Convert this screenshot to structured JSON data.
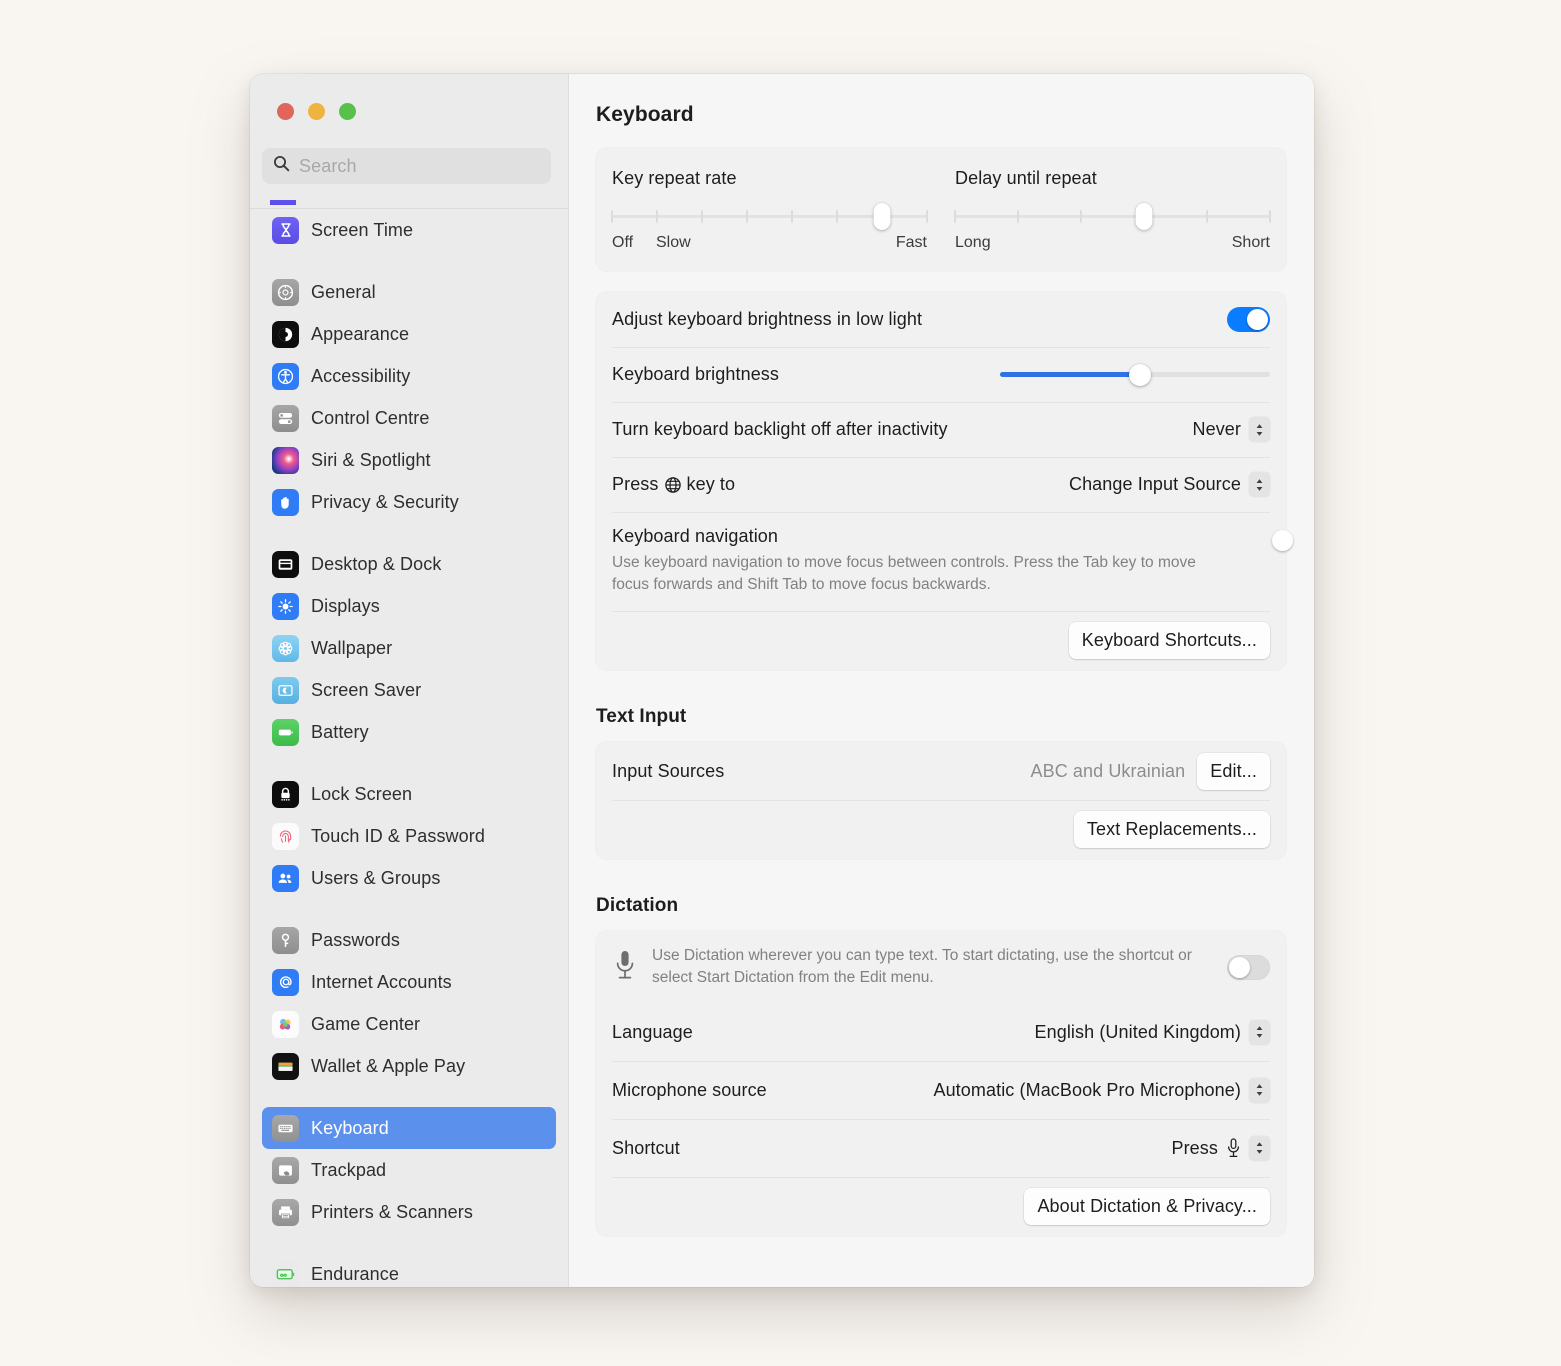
{
  "window": {
    "traffic_lights": [
      "close",
      "minimise",
      "zoom"
    ],
    "search": {
      "placeholder": "Search"
    }
  },
  "sidebar": {
    "groups": [
      {
        "items": [
          {
            "label": "Screen Time",
            "icon": "hourglass-icon"
          }
        ]
      },
      {
        "items": [
          {
            "label": "General",
            "icon": "gear-icon"
          },
          {
            "label": "Appearance",
            "icon": "appearance-icon"
          },
          {
            "label": "Accessibility",
            "icon": "accessibility-icon"
          },
          {
            "label": "Control Centre",
            "icon": "control-centre-icon"
          },
          {
            "label": "Siri & Spotlight",
            "icon": "siri-icon"
          },
          {
            "label": "Privacy & Security",
            "icon": "hand-icon"
          }
        ]
      },
      {
        "items": [
          {
            "label": "Desktop & Dock",
            "icon": "desktop-dock-icon"
          },
          {
            "label": "Displays",
            "icon": "brightness-icon"
          },
          {
            "label": "Wallpaper",
            "icon": "wallpaper-icon"
          },
          {
            "label": "Screen Saver",
            "icon": "screen-saver-icon"
          },
          {
            "label": "Battery",
            "icon": "battery-icon"
          }
        ]
      },
      {
        "items": [
          {
            "label": "Lock Screen",
            "icon": "lock-icon"
          },
          {
            "label": "Touch ID & Password",
            "icon": "fingerprint-icon"
          },
          {
            "label": "Users & Groups",
            "icon": "users-icon"
          }
        ]
      },
      {
        "items": [
          {
            "label": "Passwords",
            "icon": "key-icon"
          },
          {
            "label": "Internet Accounts",
            "icon": "at-sign-icon"
          },
          {
            "label": "Game Center",
            "icon": "game-center-icon"
          },
          {
            "label": "Wallet & Apple Pay",
            "icon": "wallet-icon"
          }
        ]
      },
      {
        "items": [
          {
            "label": "Keyboard",
            "icon": "keyboard-icon",
            "selected": true
          },
          {
            "label": "Trackpad",
            "icon": "trackpad-icon"
          },
          {
            "label": "Printers & Scanners",
            "icon": "printer-icon"
          }
        ]
      },
      {
        "items": [
          {
            "label": "Endurance",
            "icon": "infinity-icon"
          }
        ]
      }
    ]
  },
  "main": {
    "title": "Keyboard",
    "key_repeat": {
      "title": "Key repeat rate",
      "ticks": 8,
      "value_index": 6,
      "label_start": "Off",
      "label_second": "Slow",
      "label_end": "Fast"
    },
    "delay_until_repeat": {
      "title": "Delay until repeat",
      "ticks": 6,
      "value_index": 3,
      "label_start": "Long",
      "label_end": "Short"
    },
    "adjust_brightness": {
      "label": "Adjust keyboard brightness in low light",
      "enabled": true
    },
    "keyboard_brightness": {
      "label": "Keyboard brightness",
      "percent": 52
    },
    "backlight_off": {
      "label": "Turn keyboard backlight off after inactivity",
      "value": "Never"
    },
    "globe_key": {
      "label_before": "Press",
      "label_after": "key to",
      "icon": "globe-icon",
      "value": "Change Input Source"
    },
    "keyboard_navigation": {
      "title": "Keyboard navigation",
      "description": "Use keyboard navigation to move focus between controls. Press the Tab key to move focus forwards and Shift Tab to move focus backwards.",
      "enabled": false
    },
    "keyboard_shortcuts_button": "Keyboard Shortcuts...",
    "text_input": {
      "section_title": "Text Input",
      "input_sources_label": "Input Sources",
      "input_sources_value": "ABC and Ukrainian",
      "edit_button": "Edit...",
      "text_replacements_button": "Text Replacements..."
    },
    "dictation": {
      "section_title": "Dictation",
      "description": "Use Dictation wherever you can type text. To start dictating, use the shortcut or select Start Dictation from the Edit menu.",
      "enabled": false,
      "language_label": "Language",
      "language_value": "English (United Kingdom)",
      "microphone_label": "Microphone source",
      "microphone_value": "Automatic (MacBook Pro Microphone)",
      "shortcut_label": "Shortcut",
      "shortcut_value": "Press",
      "shortcut_icon": "microphone-icon",
      "about_button": "About Dictation & Privacy..."
    }
  },
  "colors": {
    "accent_blue": "#0a7cff",
    "selection_blue": "#5b91ec",
    "slider_fill": "#2f72e6",
    "page_background": "#f9f6f2"
  }
}
